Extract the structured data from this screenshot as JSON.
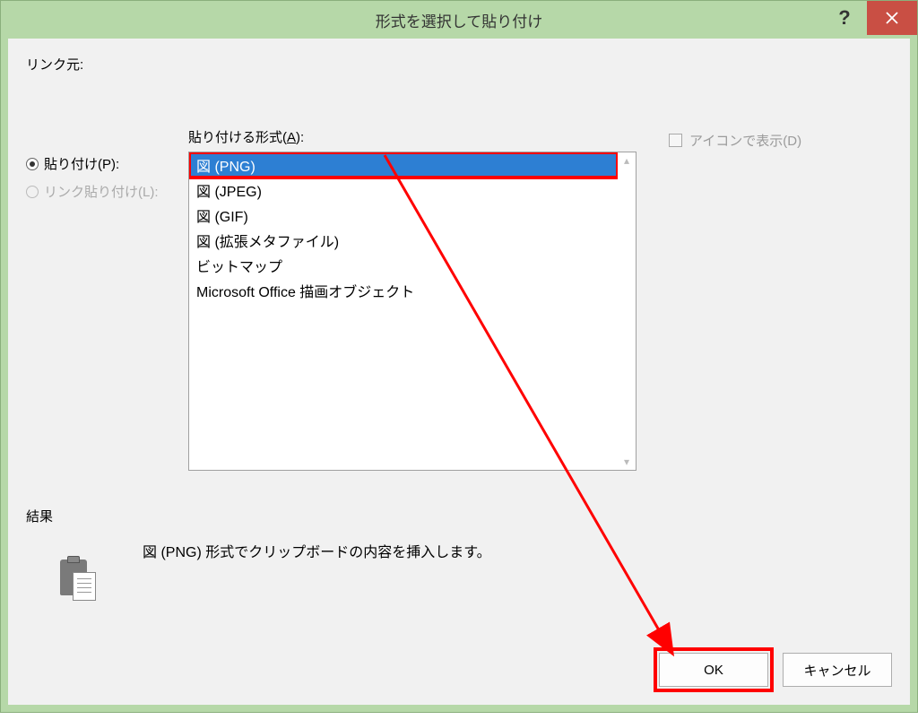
{
  "title": "形式を選択して貼り付け",
  "source_label": "リンク元:",
  "radio_paste": "貼り付け(P):",
  "radio_link_paste": "リンク貼り付け(L):",
  "format_label_prefix": "貼り付ける形式(",
  "format_label_accel": "A",
  "format_label_suffix": "):",
  "formats": [
    "図 (PNG)",
    "図 (JPEG)",
    "図 (GIF)",
    "図 (拡張メタファイル)",
    "ビットマップ",
    "Microsoft Office 描画オブジェクト"
  ],
  "as_icon_label": "アイコンで表示(D)",
  "result_heading": "結果",
  "result_text": "図 (PNG) 形式でクリップボードの内容を挿入します。",
  "ok_label": "OK",
  "cancel_label": "キャンセル"
}
